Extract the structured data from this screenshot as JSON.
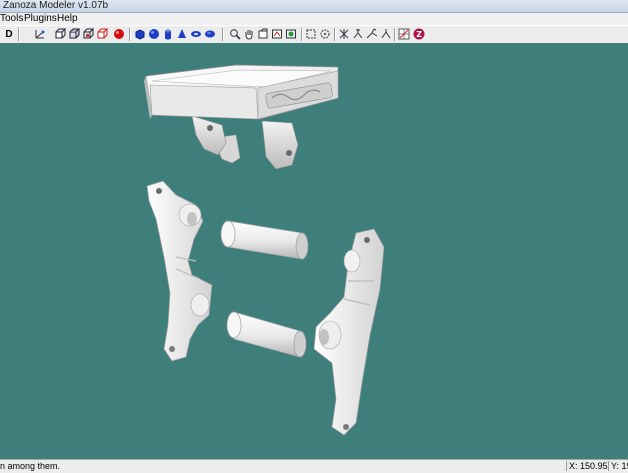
{
  "window": {
    "title": "Zanoza Modeler v1.07b"
  },
  "menu": {
    "items": [
      "Tools",
      "Plugins",
      "Help"
    ]
  },
  "toolbar": {
    "mode_label": "D",
    "icons": [
      "axes-icon",
      "cube-front-icon",
      "cube-iso-icon",
      "cube-wire-icon",
      "cube-red-icon",
      "sphere-red-icon",
      "box-primitive-icon",
      "sphere-primitive-icon",
      "cone-primitive-icon",
      "torus-primitive-icon",
      "disc-primitive-icon",
      "zoom-icon",
      "pan-hand-icon",
      "camera-rotate-icon",
      "view-front-icon",
      "view-perspective-icon",
      "select-rect-icon",
      "select-circle-icon",
      "move-icon",
      "rotate-icon",
      "scale-icon",
      "snap-grid-icon",
      "z-plugin-icon"
    ]
  },
  "status": {
    "message": "n among them.",
    "x_label": "X: 150.9557",
    "y_label": "Y: 19"
  },
  "colors": {
    "viewport": "#3e7f7c",
    "model": "#f2f2f2"
  }
}
